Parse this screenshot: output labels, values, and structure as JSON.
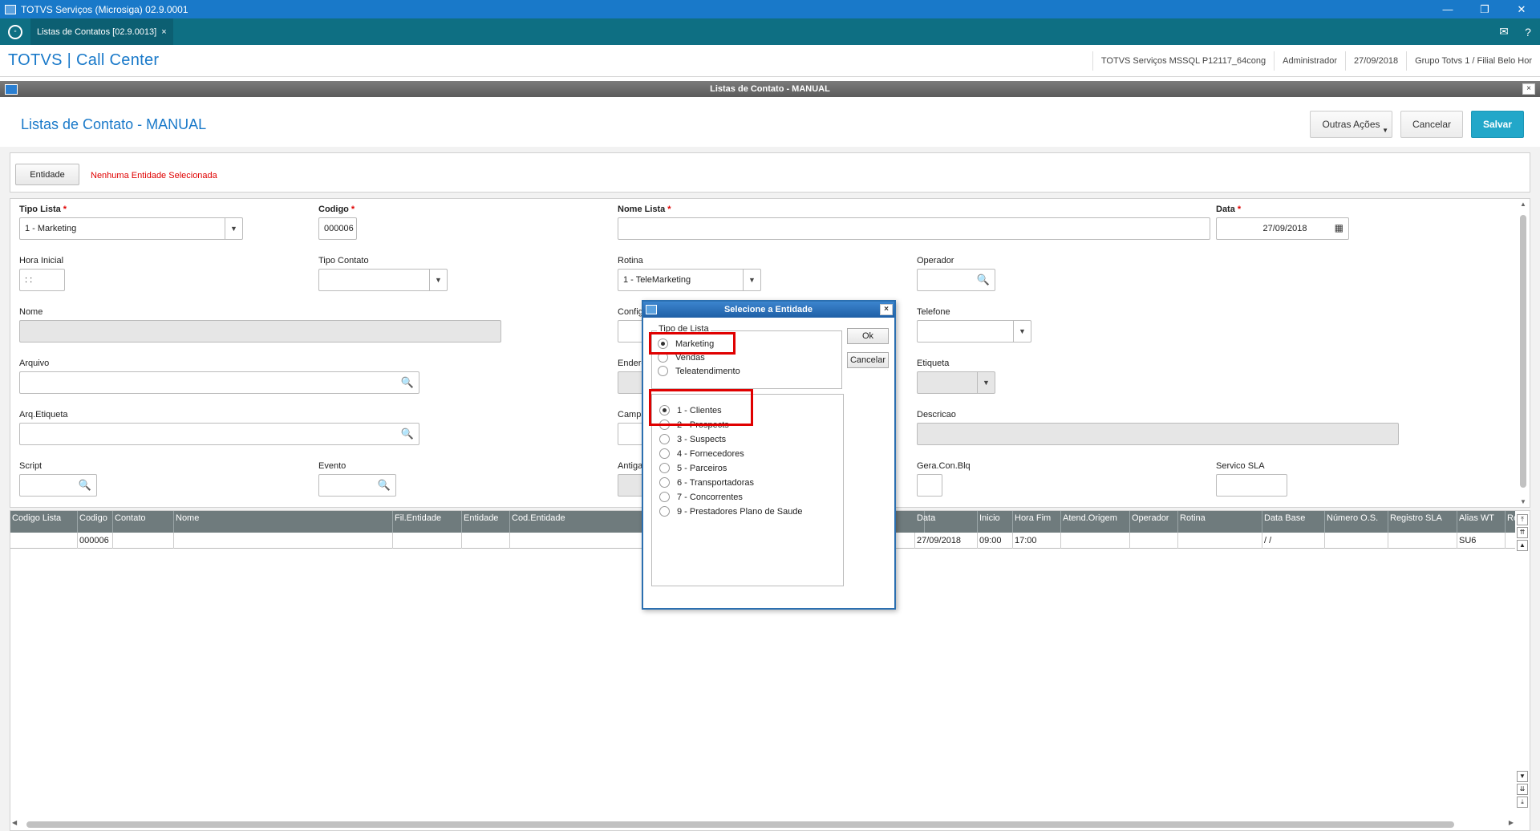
{
  "window": {
    "title": "TOTVS Serviços (Microsiga) 02.9.0001",
    "minimize": "—",
    "restore": "❐",
    "close": "✕"
  },
  "tabbar": {
    "tab_label": "Listas de Contatos [02.9.0013]",
    "tab_close": "×",
    "mail_icon": "✉",
    "help_icon": "?"
  },
  "header": {
    "brand": "TOTVS | Call Center",
    "info": [
      "TOTVS Serviços MSSQL P12117_64cong",
      "Administrador",
      "27/09/2018",
      "Grupo Totvs 1 / Filial Belo Hor"
    ]
  },
  "inner": {
    "title": "Listas de Contato - MANUAL",
    "close": "×"
  },
  "page": {
    "title": "Listas de Contato - MANUAL",
    "outras_acoes": "Outras Ações",
    "cancelar": "Cancelar",
    "salvar": "Salvar"
  },
  "entity": {
    "button": "Entidade",
    "message": "Nenhuma Entidade Selecionada"
  },
  "form": {
    "tipo_lista": {
      "label": "Tipo Lista",
      "value": "1 - Marketing"
    },
    "codigo": {
      "label": "Codigo",
      "value": "000006"
    },
    "nome_lista": {
      "label": "Nome Lista",
      "value": ""
    },
    "data": {
      "label": "Data",
      "value": "27/09/2018"
    },
    "hora_inicial": {
      "label": "Hora Inicial",
      "value": " :  :"
    },
    "tipo_contato": {
      "label": "Tipo Contato",
      "value": ""
    },
    "rotina": {
      "label": "Rotina",
      "value": "1 - TeleMarketing"
    },
    "operador": {
      "label": "Operador",
      "value": ""
    },
    "nome": {
      "label": "Nome",
      "value": ""
    },
    "config": {
      "label": "Config"
    },
    "telefone": {
      "label": "Telefone",
      "value": ""
    },
    "arquivo": {
      "label": "Arquivo",
      "value": ""
    },
    "endere": {
      "label": "Endere"
    },
    "etiqueta": {
      "label": "Etiqueta",
      "value": ""
    },
    "arq_etiqueta": {
      "label": "Arq.Etiqueta",
      "value": ""
    },
    "campa": {
      "label": "Campa"
    },
    "descricao": {
      "label": "Descricao",
      "value": ""
    },
    "script": {
      "label": "Script",
      "value": ""
    },
    "evento": {
      "label": "Evento",
      "value": ""
    },
    "antiga": {
      "label": "Antiga"
    },
    "gera_con_blq": {
      "label": "Gera.Con.Blq",
      "value": ""
    },
    "servico_sla": {
      "label": "Servico SLA",
      "value": ""
    }
  },
  "grid": {
    "headers": [
      "Codigo Lista",
      "Codigo",
      "Contato",
      "Nome",
      "Fil.Entidade",
      "Entidade",
      "Cod.Entidade",
      "Data",
      "Inicio",
      "Hora Fim",
      "Atend.Origem",
      "Operador",
      "Rotina",
      "Data Base",
      "Número O.S.",
      "Registro SLA",
      "Alias WT",
      "Re"
    ],
    "row": [
      "",
      "000006",
      "",
      "",
      "",
      "",
      "",
      "27/09/2018",
      "09:00",
      "17:00",
      "",
      "",
      "",
      " /  /",
      "",
      "",
      "SU6",
      ""
    ]
  },
  "modal": {
    "title": "Selecione a Entidade",
    "close": "×",
    "tipo_lista_label": "Tipo de Lista",
    "tipo_lista_options": [
      "Marketing",
      "Vendas",
      "Teleatendimento"
    ],
    "tipo_lista_selected": 0,
    "entity_options": [
      "1 - Clientes",
      "2 - Prospects",
      "3 - Suspects",
      "4 - Fornecedores",
      "5 - Parceiros",
      "6 - Transportadoras",
      "7 - Concorrentes",
      "9 - Prestadores Plano de Saude"
    ],
    "entity_selected": 0,
    "ok": "Ok",
    "cancelar": "Cancelar"
  }
}
